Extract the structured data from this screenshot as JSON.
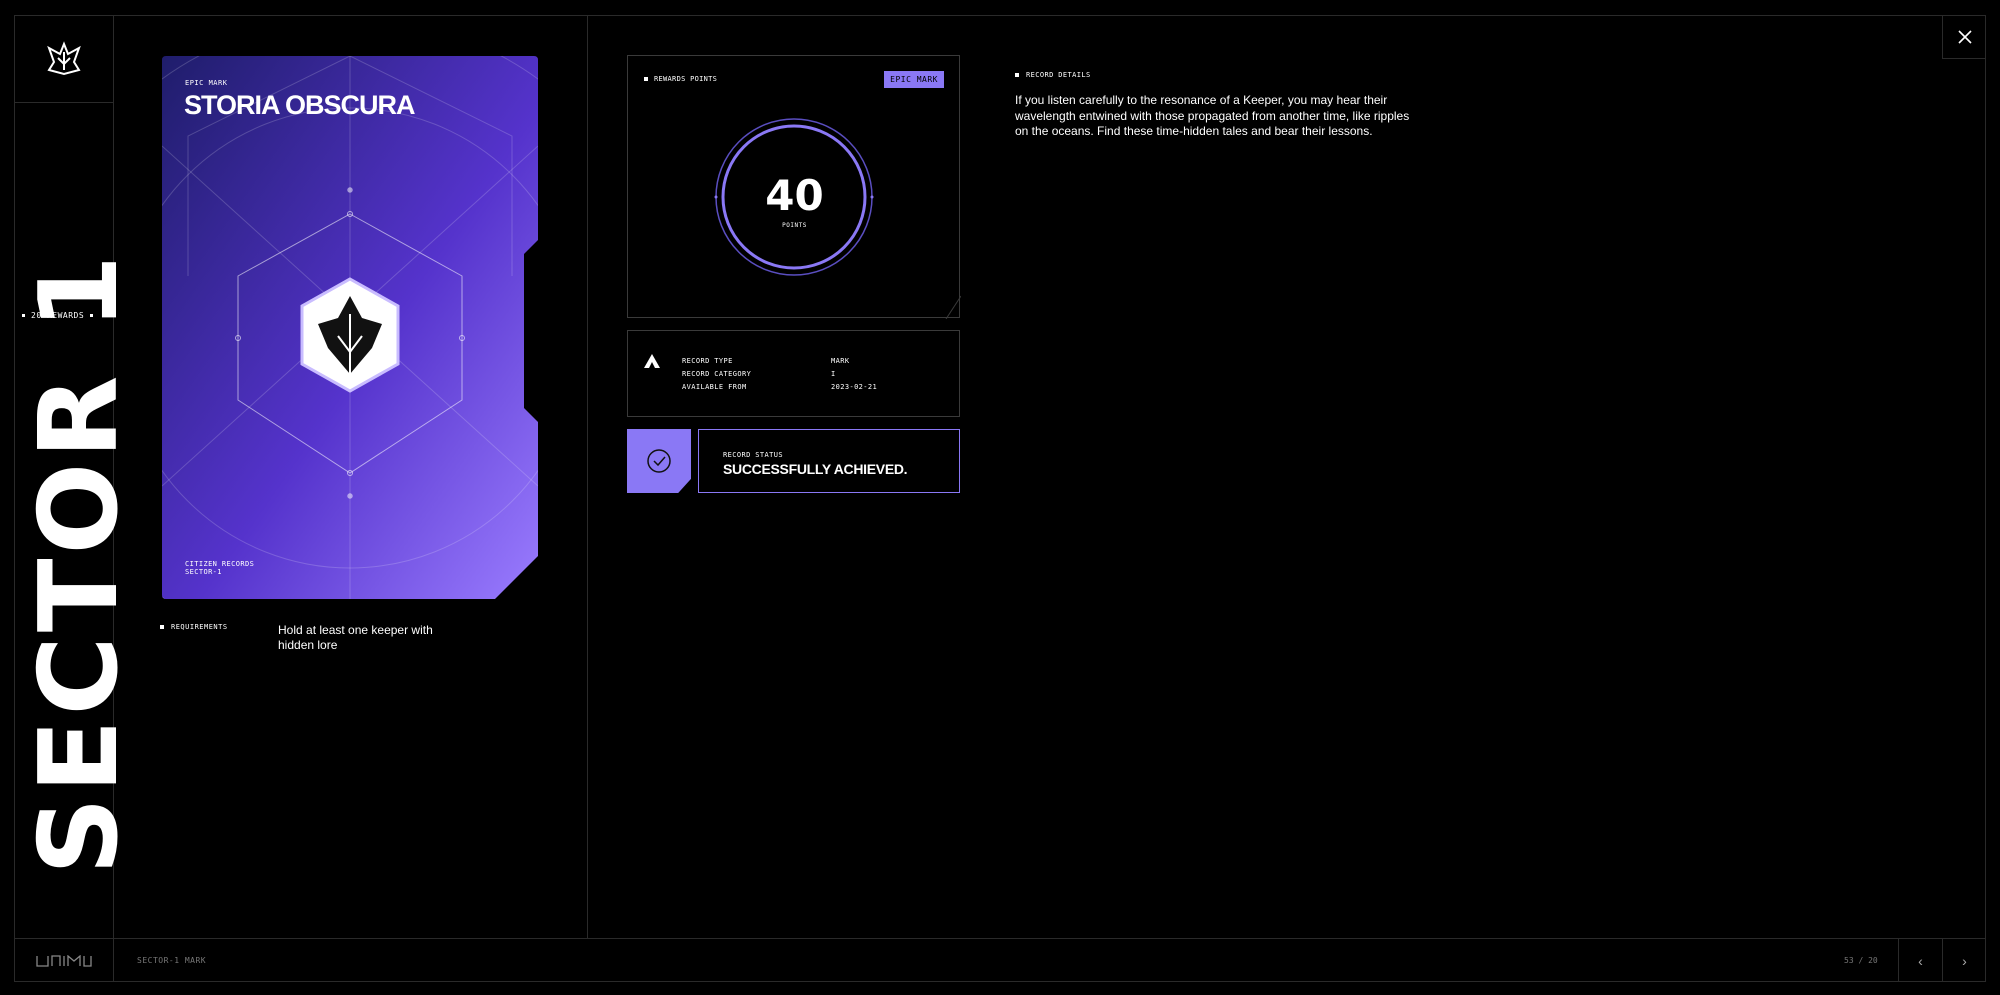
{
  "sidebar": {
    "sector_label": "SECTOR 1",
    "rewards": "20 REWARDS"
  },
  "card": {
    "type": "EPIC MARK",
    "title": "STORIA OBSCURA",
    "footer_line1": "CITIZEN RECORDS",
    "footer_line2": "SECTOR-1"
  },
  "requirements": {
    "label": "REQUIREMENTS",
    "text": "Hold at least one keeper with hidden lore"
  },
  "points_panel": {
    "label": "REWARDS POINTS",
    "badge": "EPIC MARK",
    "value": "40",
    "unit": "POINTS"
  },
  "info": {
    "rows": [
      {
        "key": "RECORD TYPE",
        "value": "MARK"
      },
      {
        "key": "RECORD CATEGORY",
        "value": "I"
      },
      {
        "key": "AVAILABLE FROM",
        "value": "2023-02-21"
      }
    ]
  },
  "status": {
    "label": "RECORD STATUS",
    "value": "SUCCESSFULLY ACHIEVED."
  },
  "details": {
    "label": "RECORD DETAILS",
    "text": "If you listen carefully to the resonance of a Keeper, you may hear their wavelength entwined with those propagated from another time, like ripples on the oceans. Find these time-hidden tales and bear their lessons."
  },
  "footer": {
    "text": "SECTOR-1 MARK",
    "page": "53 / 20"
  },
  "colors": {
    "accent": "#8a78f5",
    "card_top": "#2a2380",
    "card_bottom": "#7e5cf0"
  }
}
